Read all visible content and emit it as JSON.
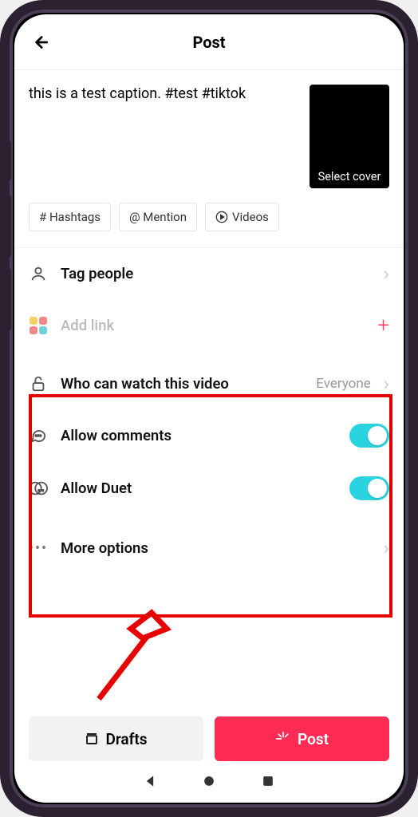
{
  "header": {
    "title": "Post"
  },
  "caption": "this is a test caption. #test #tiktok",
  "thumb": {
    "label": "Select cover"
  },
  "chips": {
    "hashtags": "# Hashtags",
    "mention": "@ Mention",
    "videos": "Videos"
  },
  "rows": {
    "tagPeople": "Tag people",
    "addLink": "Add link",
    "whoCanWatch": {
      "label": "Who can watch this video",
      "value": "Everyone"
    },
    "allowComments": "Allow comments",
    "allowDuet": "Allow Duet",
    "moreOptions": "More options"
  },
  "footer": {
    "drafts": "Drafts",
    "post": "Post"
  }
}
